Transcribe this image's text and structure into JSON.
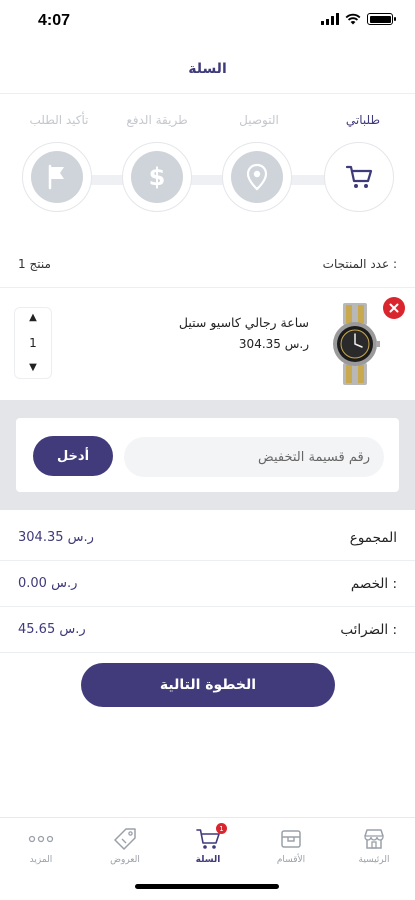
{
  "status_bar": {
    "time": "4:07"
  },
  "header": {
    "title": "السلة"
  },
  "steps": [
    {
      "label": "طلباتي",
      "icon": "cart-icon",
      "active": true
    },
    {
      "label": "التوصيل",
      "icon": "location-pin-icon",
      "active": false
    },
    {
      "label": "طريقة الدفع",
      "icon": "dollar-icon",
      "active": false
    },
    {
      "label": "تأكيد الطلب",
      "icon": "flag-icon",
      "active": false
    }
  ],
  "products_count": {
    "label": "عدد المنتجات :",
    "value": "1 منتج"
  },
  "product": {
    "name": "ساعة رجالي كاسيو ستيل",
    "price": "304.35 ر.س",
    "quantity": "1"
  },
  "coupon": {
    "placeholder": "رقم قسيمة التخفيض",
    "apply_label": "أدخل"
  },
  "summary": {
    "total": {
      "label": "المجموع",
      "value": "304.35 ر.س"
    },
    "discount": {
      "label": "الخصم :",
      "value": "0.00 ر.س"
    },
    "taxes": {
      "label": "الضرائب :",
      "value": "45.65 ر.س"
    }
  },
  "next_button": {
    "label": "الخطوة التالية"
  },
  "tabbar": {
    "items": [
      {
        "label": "الرئيسية",
        "icon": "store-icon",
        "active": false
      },
      {
        "label": "الأقسام",
        "icon": "box-icon",
        "active": false
      },
      {
        "label": "السلة",
        "icon": "cart-icon",
        "active": true,
        "badge": "1"
      },
      {
        "label": "العروض",
        "icon": "tag-icon",
        "active": false
      },
      {
        "label": "المزيد",
        "icon": "more-dots-icon",
        "active": false
      }
    ]
  },
  "colors": {
    "primary": "#413b7c",
    "danger": "#d9252e",
    "inactive": "#cfd4da"
  }
}
